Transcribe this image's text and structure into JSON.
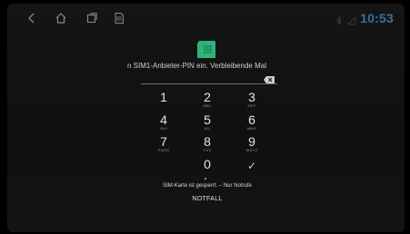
{
  "statusbar": {
    "time": "10:53",
    "nav_icons": [
      "back-icon",
      "home-icon",
      "recents-icon",
      "sim-card-icon"
    ],
    "clock_color": "#3d6f9c"
  },
  "sim": {
    "icon": "sim-card-icon",
    "icon_color": "#2fb37a",
    "prompt": "n SIM1-Anbieter-PIN ein. Verbleibende Mal"
  },
  "keypad": {
    "keys": [
      {
        "digit": "1",
        "letters": ""
      },
      {
        "digit": "2",
        "letters": "ABC"
      },
      {
        "digit": "3",
        "letters": "DEF"
      },
      {
        "digit": "4",
        "letters": "GHI"
      },
      {
        "digit": "5",
        "letters": "JKL"
      },
      {
        "digit": "6",
        "letters": "MNO"
      },
      {
        "digit": "7",
        "letters": "PQRS"
      },
      {
        "digit": "8",
        "letters": "TUV"
      },
      {
        "digit": "9",
        "letters": "WXYZ"
      },
      {
        "digit": "0",
        "letters": ""
      },
      {
        "digit": "✓",
        "letters": ""
      }
    ]
  },
  "footer": {
    "locked_message": "SIM-Karte ist gesperrt. – Nur Notrufe",
    "emergency_label": "NOTFALL"
  }
}
